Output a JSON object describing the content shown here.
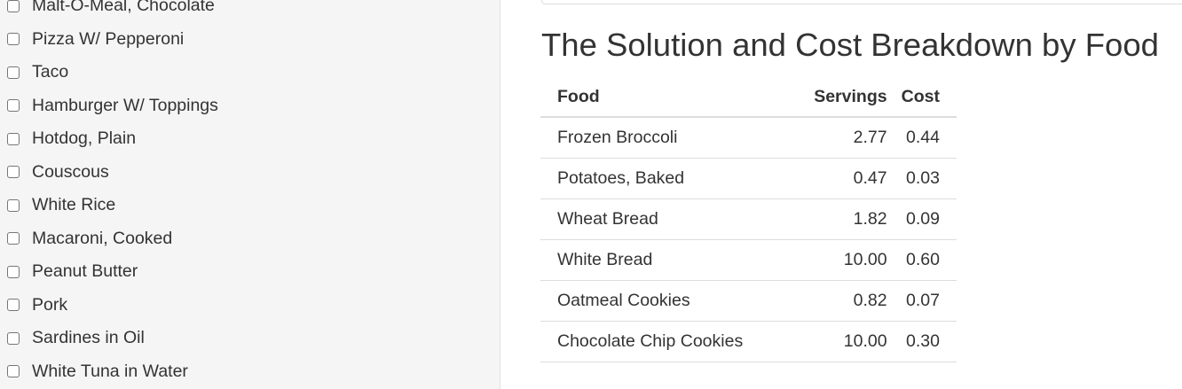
{
  "sidebar": {
    "food_items": [
      {
        "label": "Malt-O-Meal, Chocolate",
        "checked": false
      },
      {
        "label": "Pizza W/ Pepperoni",
        "checked": false
      },
      {
        "label": "Taco",
        "checked": false
      },
      {
        "label": "Hamburger W/ Toppings",
        "checked": false
      },
      {
        "label": "Hotdog, Plain",
        "checked": false
      },
      {
        "label": "Couscous",
        "checked": false
      },
      {
        "label": "White Rice",
        "checked": false
      },
      {
        "label": "Macaroni, Cooked",
        "checked": false
      },
      {
        "label": "Peanut Butter",
        "checked": false
      },
      {
        "label": "Pork",
        "checked": false
      },
      {
        "label": "Sardines in Oil",
        "checked": false
      },
      {
        "label": "White Tuna in Water",
        "checked": false
      }
    ]
  },
  "main": {
    "title": "The Solution and Cost Breakdown by Food",
    "table": {
      "headers": {
        "food": "Food",
        "servings": "Servings",
        "cost": "Cost"
      },
      "rows": [
        {
          "food": "Frozen Broccoli",
          "servings": "2.77",
          "cost": "0.44"
        },
        {
          "food": "Potatoes, Baked",
          "servings": "0.47",
          "cost": "0.03"
        },
        {
          "food": "Wheat Bread",
          "servings": "1.82",
          "cost": "0.09"
        },
        {
          "food": "White Bread",
          "servings": "10.00",
          "cost": "0.60"
        },
        {
          "food": "Oatmeal Cookies",
          "servings": "0.82",
          "cost": "0.07"
        },
        {
          "food": "Chocolate Chip Cookies",
          "servings": "10.00",
          "cost": "0.30"
        }
      ]
    }
  }
}
